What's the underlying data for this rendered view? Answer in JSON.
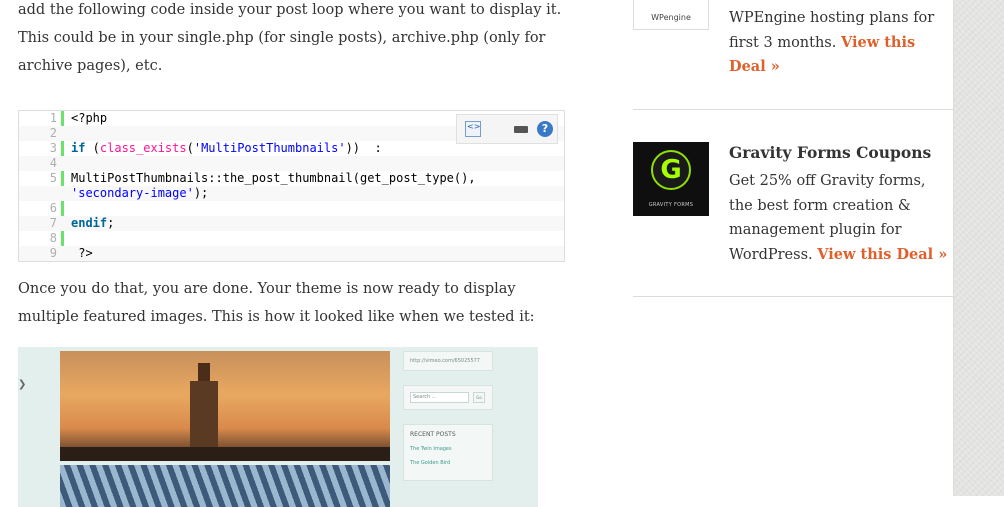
{
  "article": {
    "para1": "add the following code inside your post loop where you want to display it. This could be in your single.php (for single posts), archive.php (only for archive pages), etc.",
    "para2": "Once you do that, you are done. Your theme is now ready to display multiple featured images. This is how it looked like when we tested it:"
  },
  "code": {
    "lines": [
      {
        "num": "1",
        "tokens": [
          {
            "t": "<?php",
            "c": ""
          }
        ]
      },
      {
        "num": "2",
        "tokens": []
      },
      {
        "num": "3",
        "tokens": [
          {
            "t": "if",
            "c": "kw"
          },
          {
            "t": " (",
            "c": ""
          },
          {
            "t": "class_exists",
            "c": "fn"
          },
          {
            "t": "(",
            "c": ""
          },
          {
            "t": "'MultiPostThumbnails'",
            "c": "str"
          },
          {
            "t": "))  :",
            "c": ""
          }
        ]
      },
      {
        "num": "4",
        "tokens": []
      },
      {
        "num": "5",
        "tokens": [
          {
            "t": "MultiPostThumbnails::the_post_thumbnail(get_post_type(),",
            "c": ""
          }
        ]
      },
      {
        "num": "",
        "tokens": [
          {
            "t": "'secondary-image'",
            "c": "str"
          },
          {
            "t": ");",
            "c": ""
          }
        ]
      },
      {
        "num": "6",
        "tokens": []
      },
      {
        "num": "7",
        "tokens": [
          {
            "t": "endif",
            "c": "kw"
          },
          {
            "t": ";",
            "c": ""
          }
        ]
      },
      {
        "num": "8",
        "tokens": []
      },
      {
        "num": "9",
        "tokens": [
          {
            "t": " ?>",
            "c": ""
          }
        ]
      }
    ],
    "help_label": "?"
  },
  "screenshot": {
    "url_text": "http://vimeo.com/65025577",
    "search_placeholder": "Search ...",
    "go_label": "Go",
    "recent_posts_title": "RECENT POSTS",
    "recent_posts": [
      "The Twin Images",
      "The Golden Bird"
    ]
  },
  "sidebar": {
    "wpengine": {
      "logo_text": "WPengine",
      "text": "WPEngine hosting plans for first 3 months.",
      "link": "View this Deal »"
    },
    "gravity": {
      "logo_letter": "G",
      "logo_caption": "GRAVITY FORMS",
      "title": "Gravity Forms Coupons",
      "text": "Get 25% off Gravity forms, the best form creation & management plugin for WordPress.",
      "link": "View this Deal »"
    }
  },
  "colors": {
    "accent": "#e0602c",
    "code_gutter": "#6ce26c"
  }
}
